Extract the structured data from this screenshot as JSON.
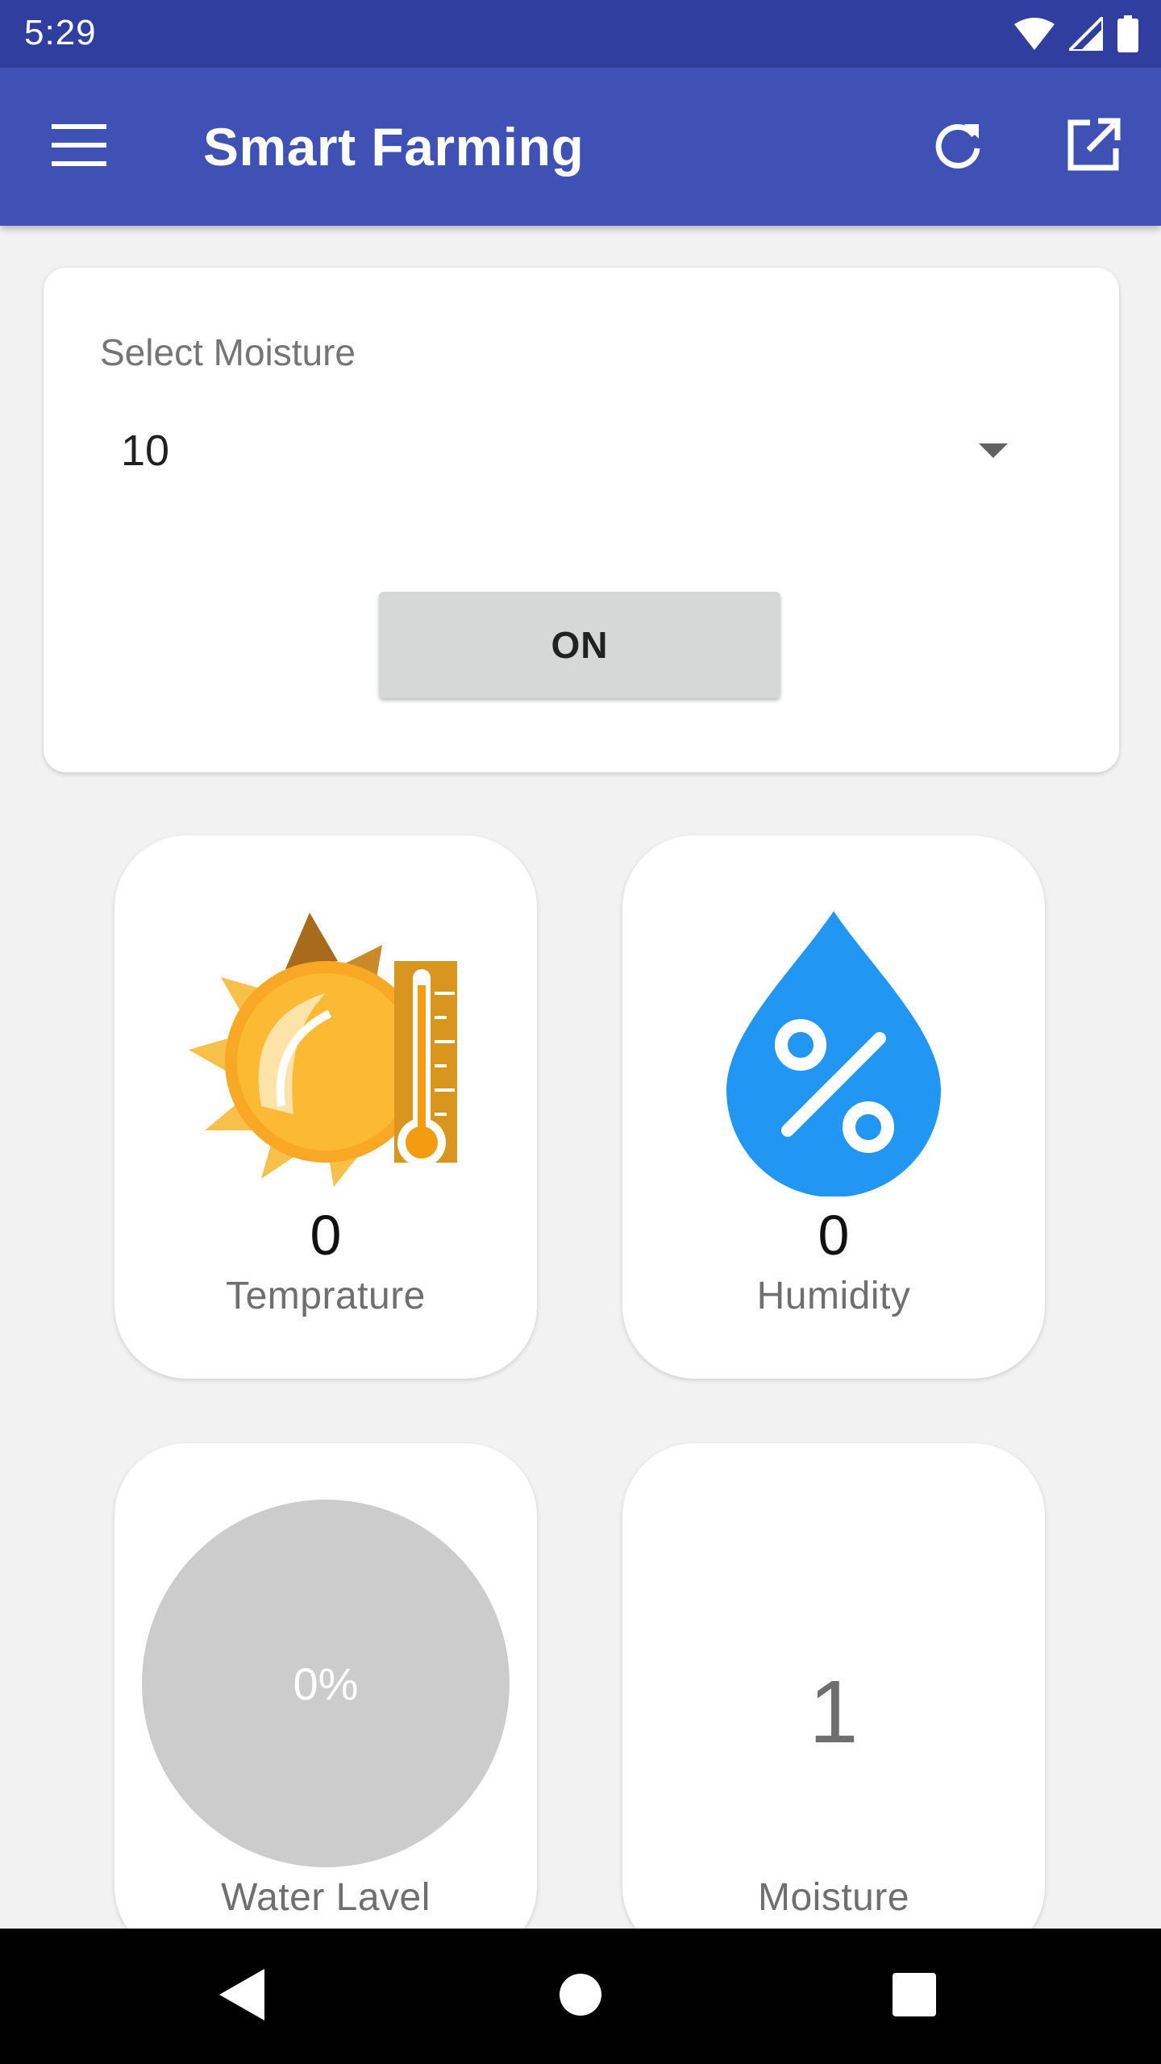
{
  "status_bar": {
    "time": "5:29",
    "icons": [
      "wifi-icon",
      "signal-icon",
      "battery-icon"
    ]
  },
  "app_bar": {
    "title": "Smart Farming",
    "menu_icon": "menu-icon",
    "actions": [
      "refresh-icon",
      "open-external-icon"
    ]
  },
  "moisture_selector": {
    "label": "Select Moisture",
    "selected_value": "10",
    "button_label": "ON"
  },
  "tiles": {
    "temperature": {
      "value": "0",
      "label": "Temprature",
      "icon": "sun-thermometer-icon"
    },
    "humidity": {
      "value": "0",
      "label": "Humidity",
      "icon": "humidity-drop-icon"
    },
    "water_level": {
      "value": "0%",
      "label": "Water Lavel",
      "level": 0
    },
    "moisture": {
      "value": "1",
      "label": "Moisture"
    }
  },
  "nav_bar": {
    "buttons": [
      "back-icon",
      "home-icon",
      "recents-icon"
    ]
  },
  "colors": {
    "status_bar": "#303f9f",
    "app_bar": "#3f51b5",
    "humidity_drop": "#2196f3",
    "sun": "#f9a825",
    "gauge": "#cccccc"
  }
}
